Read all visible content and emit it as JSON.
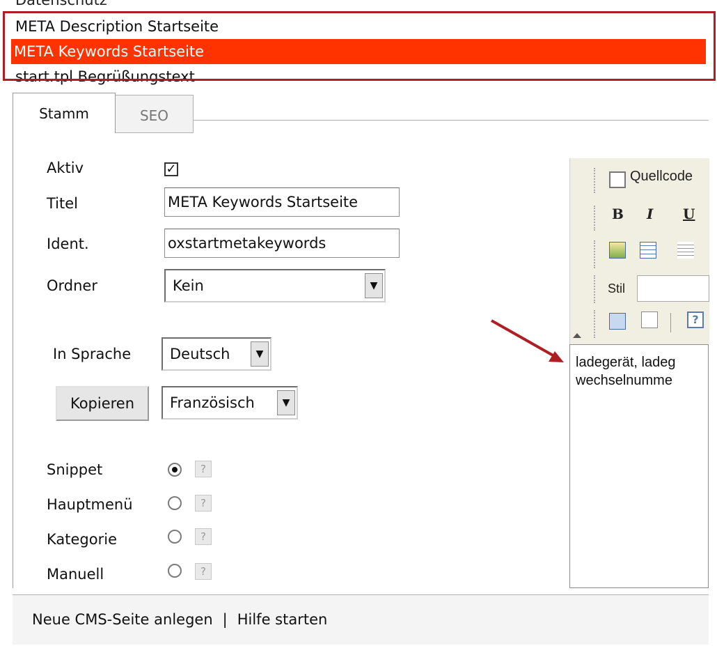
{
  "list": {
    "items": [
      {
        "label": "Datenschutz"
      },
      {
        "label": "META Description Startseite"
      },
      {
        "label": "META Keywords Startseite"
      },
      {
        "label": "start.tpl Begrüßungstext"
      }
    ]
  },
  "tabs": [
    {
      "label": "Stamm"
    },
    {
      "label": "SEO"
    }
  ],
  "form": {
    "aktiv_label": "Aktiv",
    "titel_label": "Titel",
    "titel_value": "META Keywords Startseite",
    "ident_label": "Ident.",
    "ident_value": "oxstartmetakeywords",
    "ordner_label": "Ordner",
    "ordner_value": "Kein",
    "sprache_label": "In Sprache",
    "sprache_value": "Deutsch",
    "kopieren_label": "Kopieren",
    "kopieren_target": "Französisch",
    "snippet_label": "Snippet",
    "hauptmenue_label": "Hauptmenü",
    "kategorie_label": "Kategorie",
    "manuell_label": "Manuell",
    "help_glyph": "?"
  },
  "editor": {
    "source_label": "Quellcode",
    "bold": "B",
    "italic": "I",
    "underline": "U",
    "style_label": "Stil",
    "content_line1": "ladegerät, ladeg",
    "content_line2": "wechselnumme"
  },
  "footer": {
    "new_page": "Neue CMS-Seite anlegen",
    "separator": "|",
    "help": "Hilfe starten"
  },
  "colors": {
    "selection": "#ff3300",
    "highlight_frame": "#b01e23",
    "arrow": "#b01e23"
  }
}
